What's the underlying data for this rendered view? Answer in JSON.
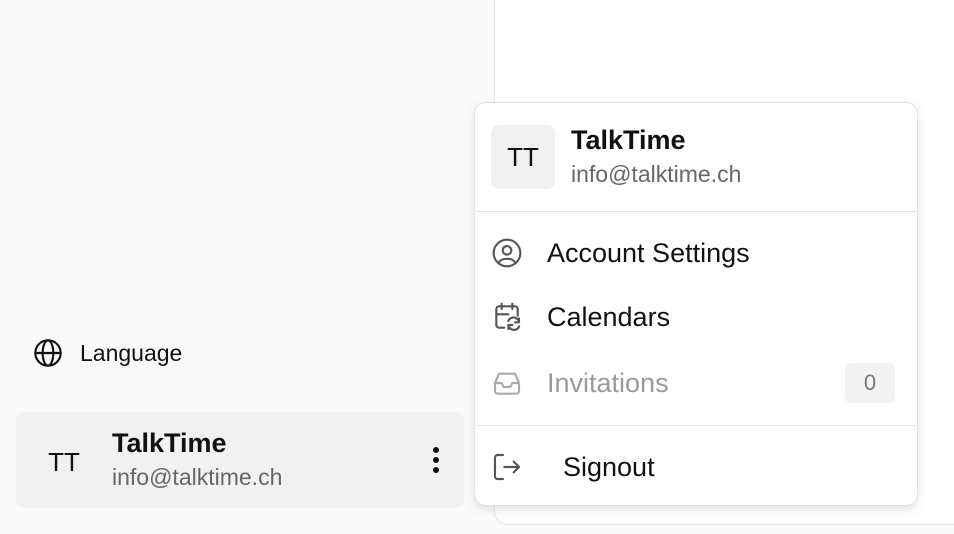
{
  "sidebar": {
    "language_label": "Language",
    "user": {
      "initials": "TT",
      "name": "TalkTime",
      "email": "info@talktime.ch"
    }
  },
  "menu": {
    "user": {
      "initials": "TT",
      "name": "TalkTime",
      "email": "info@talktime.ch"
    },
    "items": [
      {
        "label": "Account Settings",
        "icon": "user-circle-icon"
      },
      {
        "label": "Calendars",
        "icon": "calendar-sync-icon"
      },
      {
        "label": "Invitations",
        "icon": "inbox-icon",
        "badge": "0",
        "disabled": true
      }
    ],
    "signout_label": "Signout"
  }
}
